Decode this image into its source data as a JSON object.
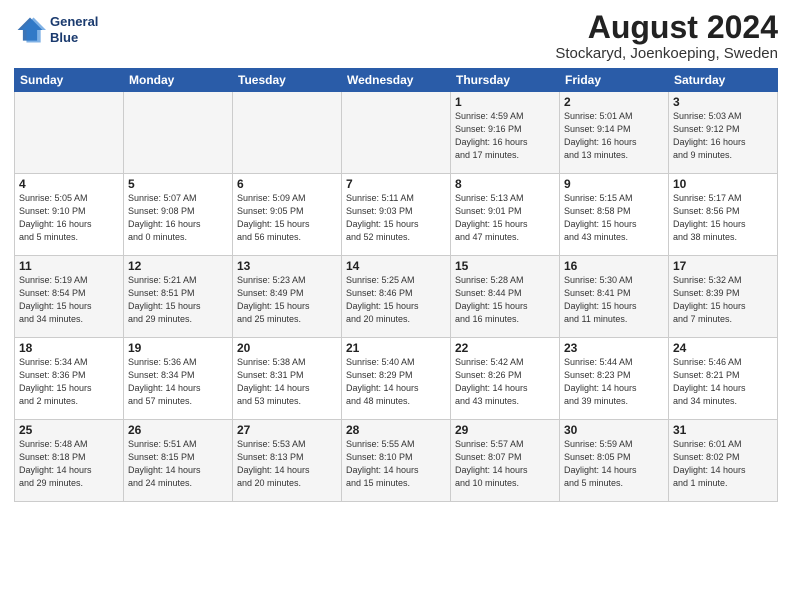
{
  "header": {
    "logo_line1": "General",
    "logo_line2": "Blue",
    "month": "August 2024",
    "location": "Stockaryd, Joenkoeping, Sweden"
  },
  "days_of_week": [
    "Sunday",
    "Monday",
    "Tuesday",
    "Wednesday",
    "Thursday",
    "Friday",
    "Saturday"
  ],
  "weeks": [
    [
      {
        "day": "",
        "info": ""
      },
      {
        "day": "",
        "info": ""
      },
      {
        "day": "",
        "info": ""
      },
      {
        "day": "",
        "info": ""
      },
      {
        "day": "1",
        "info": "Sunrise: 4:59 AM\nSunset: 9:16 PM\nDaylight: 16 hours\nand 17 minutes."
      },
      {
        "day": "2",
        "info": "Sunrise: 5:01 AM\nSunset: 9:14 PM\nDaylight: 16 hours\nand 13 minutes."
      },
      {
        "day": "3",
        "info": "Sunrise: 5:03 AM\nSunset: 9:12 PM\nDaylight: 16 hours\nand 9 minutes."
      }
    ],
    [
      {
        "day": "4",
        "info": "Sunrise: 5:05 AM\nSunset: 9:10 PM\nDaylight: 16 hours\nand 5 minutes."
      },
      {
        "day": "5",
        "info": "Sunrise: 5:07 AM\nSunset: 9:08 PM\nDaylight: 16 hours\nand 0 minutes."
      },
      {
        "day": "6",
        "info": "Sunrise: 5:09 AM\nSunset: 9:05 PM\nDaylight: 15 hours\nand 56 minutes."
      },
      {
        "day": "7",
        "info": "Sunrise: 5:11 AM\nSunset: 9:03 PM\nDaylight: 15 hours\nand 52 minutes."
      },
      {
        "day": "8",
        "info": "Sunrise: 5:13 AM\nSunset: 9:01 PM\nDaylight: 15 hours\nand 47 minutes."
      },
      {
        "day": "9",
        "info": "Sunrise: 5:15 AM\nSunset: 8:58 PM\nDaylight: 15 hours\nand 43 minutes."
      },
      {
        "day": "10",
        "info": "Sunrise: 5:17 AM\nSunset: 8:56 PM\nDaylight: 15 hours\nand 38 minutes."
      }
    ],
    [
      {
        "day": "11",
        "info": "Sunrise: 5:19 AM\nSunset: 8:54 PM\nDaylight: 15 hours\nand 34 minutes."
      },
      {
        "day": "12",
        "info": "Sunrise: 5:21 AM\nSunset: 8:51 PM\nDaylight: 15 hours\nand 29 minutes."
      },
      {
        "day": "13",
        "info": "Sunrise: 5:23 AM\nSunset: 8:49 PM\nDaylight: 15 hours\nand 25 minutes."
      },
      {
        "day": "14",
        "info": "Sunrise: 5:25 AM\nSunset: 8:46 PM\nDaylight: 15 hours\nand 20 minutes."
      },
      {
        "day": "15",
        "info": "Sunrise: 5:28 AM\nSunset: 8:44 PM\nDaylight: 15 hours\nand 16 minutes."
      },
      {
        "day": "16",
        "info": "Sunrise: 5:30 AM\nSunset: 8:41 PM\nDaylight: 15 hours\nand 11 minutes."
      },
      {
        "day": "17",
        "info": "Sunrise: 5:32 AM\nSunset: 8:39 PM\nDaylight: 15 hours\nand 7 minutes."
      }
    ],
    [
      {
        "day": "18",
        "info": "Sunrise: 5:34 AM\nSunset: 8:36 PM\nDaylight: 15 hours\nand 2 minutes."
      },
      {
        "day": "19",
        "info": "Sunrise: 5:36 AM\nSunset: 8:34 PM\nDaylight: 14 hours\nand 57 minutes."
      },
      {
        "day": "20",
        "info": "Sunrise: 5:38 AM\nSunset: 8:31 PM\nDaylight: 14 hours\nand 53 minutes."
      },
      {
        "day": "21",
        "info": "Sunrise: 5:40 AM\nSunset: 8:29 PM\nDaylight: 14 hours\nand 48 minutes."
      },
      {
        "day": "22",
        "info": "Sunrise: 5:42 AM\nSunset: 8:26 PM\nDaylight: 14 hours\nand 43 minutes."
      },
      {
        "day": "23",
        "info": "Sunrise: 5:44 AM\nSunset: 8:23 PM\nDaylight: 14 hours\nand 39 minutes."
      },
      {
        "day": "24",
        "info": "Sunrise: 5:46 AM\nSunset: 8:21 PM\nDaylight: 14 hours\nand 34 minutes."
      }
    ],
    [
      {
        "day": "25",
        "info": "Sunrise: 5:48 AM\nSunset: 8:18 PM\nDaylight: 14 hours\nand 29 minutes."
      },
      {
        "day": "26",
        "info": "Sunrise: 5:51 AM\nSunset: 8:15 PM\nDaylight: 14 hours\nand 24 minutes."
      },
      {
        "day": "27",
        "info": "Sunrise: 5:53 AM\nSunset: 8:13 PM\nDaylight: 14 hours\nand 20 minutes."
      },
      {
        "day": "28",
        "info": "Sunrise: 5:55 AM\nSunset: 8:10 PM\nDaylight: 14 hours\nand 15 minutes."
      },
      {
        "day": "29",
        "info": "Sunrise: 5:57 AM\nSunset: 8:07 PM\nDaylight: 14 hours\nand 10 minutes."
      },
      {
        "day": "30",
        "info": "Sunrise: 5:59 AM\nSunset: 8:05 PM\nDaylight: 14 hours\nand 5 minutes."
      },
      {
        "day": "31",
        "info": "Sunrise: 6:01 AM\nSunset: 8:02 PM\nDaylight: 14 hours\nand 1 minute."
      }
    ]
  ]
}
